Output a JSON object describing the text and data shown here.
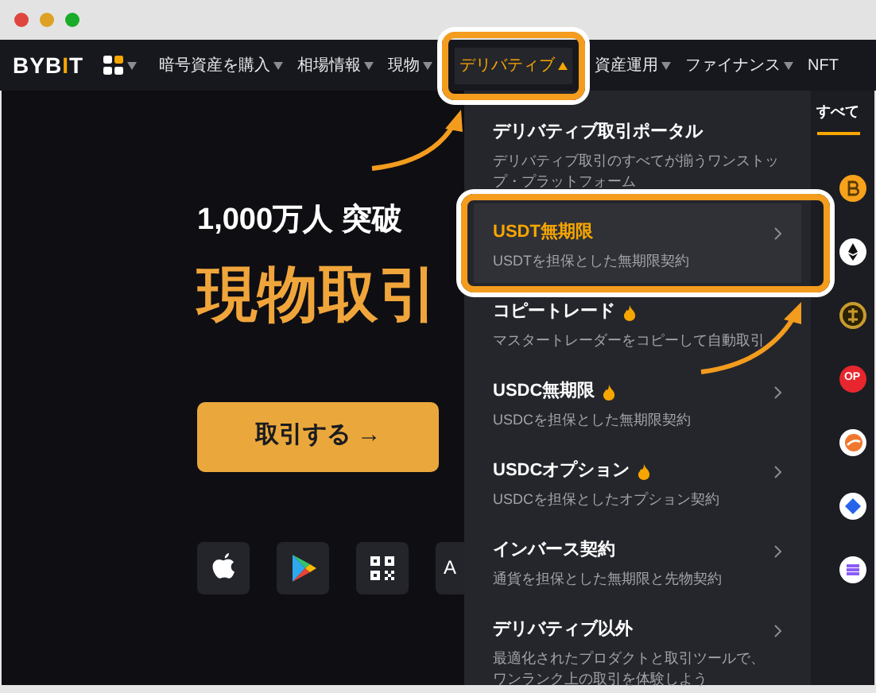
{
  "logo": {
    "prefix": "BYB",
    "accent": "I",
    "suffix": "T"
  },
  "nav": [
    {
      "label": "暗号資産を購入",
      "caret": true,
      "selected": false
    },
    {
      "label": "相場情報",
      "caret": true,
      "selected": false
    },
    {
      "label": "現物",
      "caret": true,
      "selected": false
    },
    {
      "label": "デリバティブ",
      "caret": true,
      "selected": true
    },
    {
      "label": "資産運用",
      "caret": true,
      "selected": false
    },
    {
      "label": "ファイナンス",
      "caret": true,
      "selected": false
    },
    {
      "label": "NFT",
      "caret": false,
      "selected": false
    }
  ],
  "hero": {
    "subtitle": "1,000万人 突破",
    "headline": "現物取引",
    "button": "取引する →",
    "store_tail": "A"
  },
  "menu": [
    {
      "title": "デリバティブ取引ポータル",
      "description": "デリバティブ取引のすべてが揃うワンストップ・プラットフォーム",
      "hot": false,
      "chevron": false,
      "selected": false
    },
    {
      "title": "USDT無期限",
      "description": "USDTを担保とした無期限契約",
      "hot": false,
      "chevron": true,
      "selected": true
    },
    {
      "title": "コピートレード",
      "description": "マスタートレーダーをコピーして自動取引",
      "hot": true,
      "chevron": false,
      "selected": false
    },
    {
      "title": "USDC無期限",
      "description": "USDCを担保とした無期限契約",
      "hot": true,
      "chevron": true,
      "selected": false
    },
    {
      "title": "USDCオプション",
      "description": "USDCを担保としたオプション契約",
      "hot": true,
      "chevron": true,
      "selected": false
    },
    {
      "title": "インバース契約",
      "description": "通貨を担保とした無期限と先物契約",
      "hot": false,
      "chevron": true,
      "selected": false
    },
    {
      "title": "デリバティブ以外",
      "description": "最適化されたプロダクトと取引ツールで、ワンランク上の取引を体験しよう",
      "hot": false,
      "chevron": true,
      "selected": false
    }
  ],
  "side_panel": {
    "tab": "すべて",
    "coins": [
      {
        "kind": "bitcoin",
        "color": "#f7a21b"
      },
      {
        "kind": "ether",
        "color": "#ffffff"
      },
      {
        "kind": "ring",
        "color": "#c99a2e"
      },
      {
        "kind": "text",
        "color": "#e8262d",
        "label": "OP"
      },
      {
        "kind": "swirl",
        "color": "#f0772e"
      },
      {
        "kind": "diamond",
        "color": "#2563eb"
      },
      {
        "kind": "stripes",
        "color": "#8b5cf6"
      }
    ]
  }
}
